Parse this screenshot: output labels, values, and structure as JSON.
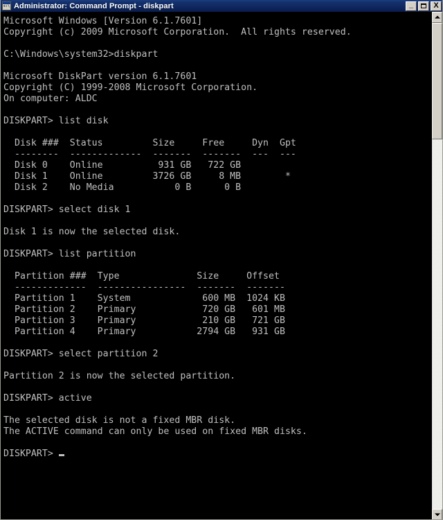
{
  "window": {
    "title": "Administrator: Command Prompt - diskpart",
    "icon": "console-icon",
    "icon_glyph": "c:\\",
    "controls": {
      "minimize": "_",
      "maximize": "□",
      "close": "X"
    },
    "colors": {
      "titlebar_start": "#1c3e80",
      "titlebar_end": "#0a1d4c",
      "console_background": "#000000",
      "console_foreground": "#c0c0c0",
      "chrome": "#d4d0c8"
    }
  },
  "scrollbar": {
    "up_arrow": "▲",
    "down_arrow": "▼",
    "thumb_top_pct": 0,
    "thumb_height_pct": 24
  },
  "console": {
    "prompt": "DISKPART>",
    "shell_prompt": "C:\\Windows\\system32>",
    "cursor": "_",
    "banner": {
      "os_version": "Microsoft Windows [Version 6.1.7601]",
      "os_copyright": "Copyright (c) 2009 Microsoft Corporation.  All rights reserved."
    },
    "diskpart_banner": {
      "version": "Microsoft DiskPart version 6.1.7601",
      "copyright": "Copyright (C) 1999-2008 Microsoft Corporation.",
      "computer": "On computer: ALDC"
    },
    "commands": {
      "launch": "diskpart",
      "list_disk": "list disk",
      "select_disk": "select disk 1",
      "list_partition": "list partition",
      "select_partition": "select partition 2",
      "active": "active"
    },
    "messages": {
      "disk_selected": "Disk 1 is now the selected disk.",
      "partition_selected": "Partition 2 is now the selected partition.",
      "error_line1": "The selected disk is not a fixed MBR disk.",
      "error_line2": "The ACTIVE command can only be used on fixed MBR disks."
    },
    "disk_table": {
      "headers": [
        "Disk ###",
        "Status",
        "Size",
        "Free",
        "Dyn",
        "Gpt"
      ],
      "separators": [
        "--------",
        "-------------",
        "-------",
        "-------",
        "---",
        "---"
      ],
      "rows": [
        {
          "disk": "Disk 0",
          "status": "Online",
          "size": "931 GB",
          "free": "722 GB",
          "dyn": "",
          "gpt": ""
        },
        {
          "disk": "Disk 1",
          "status": "Online",
          "size": "3726 GB",
          "free": "8 MB",
          "dyn": "",
          "gpt": "*"
        },
        {
          "disk": "Disk 2",
          "status": "No Media",
          "size": "0 B",
          "free": "0 B",
          "dyn": "",
          "gpt": ""
        }
      ]
    },
    "partition_table": {
      "headers": [
        "Partition ###",
        "Type",
        "Size",
        "Offset"
      ],
      "separators": [
        "-------------",
        "----------------",
        "-------",
        "-------"
      ],
      "rows": [
        {
          "partition": "Partition 1",
          "type": "System",
          "size": "600 MB",
          "offset": "1024 KB"
        },
        {
          "partition": "Partition 2",
          "type": "Primary",
          "size": "720 GB",
          "offset": "601 MB"
        },
        {
          "partition": "Partition 3",
          "type": "Primary",
          "size": "210 GB",
          "offset": "721 GB"
        },
        {
          "partition": "Partition 4",
          "type": "Primary",
          "size": "2794 GB",
          "offset": "931 GB"
        }
      ]
    },
    "screen_lines": [
      "Microsoft Windows [Version 6.1.7601]",
      "Copyright (c) 2009 Microsoft Corporation.  All rights reserved.",
      "",
      "C:\\Windows\\system32>diskpart",
      "",
      "Microsoft DiskPart version 6.1.7601",
      "Copyright (C) 1999-2008 Microsoft Corporation.",
      "On computer: ALDC",
      "",
      "DISKPART> list disk",
      "",
      "  Disk ###  Status         Size     Free     Dyn  Gpt",
      "  --------  -------------  -------  -------  ---  ---",
      "  Disk 0    Online          931 GB   722 GB",
      "  Disk 1    Online         3726 GB     8 MB        *",
      "  Disk 2    No Media           0 B      0 B",
      "",
      "DISKPART> select disk 1",
      "",
      "Disk 1 is now the selected disk.",
      "",
      "DISKPART> list partition",
      "",
      "  Partition ###  Type              Size     Offset",
      "  -------------  ----------------  -------  -------",
      "  Partition 1    System             600 MB  1024 KB",
      "  Partition 2    Primary            720 GB   601 MB",
      "  Partition 3    Primary            210 GB   721 GB",
      "  Partition 4    Primary           2794 GB   931 GB",
      "",
      "DISKPART> select partition 2",
      "",
      "Partition 2 is now the selected partition.",
      "",
      "DISKPART> active",
      "",
      "The selected disk is not a fixed MBR disk.",
      "The ACTIVE command can only be used on fixed MBR disks.",
      "",
      "DISKPART> "
    ]
  }
}
